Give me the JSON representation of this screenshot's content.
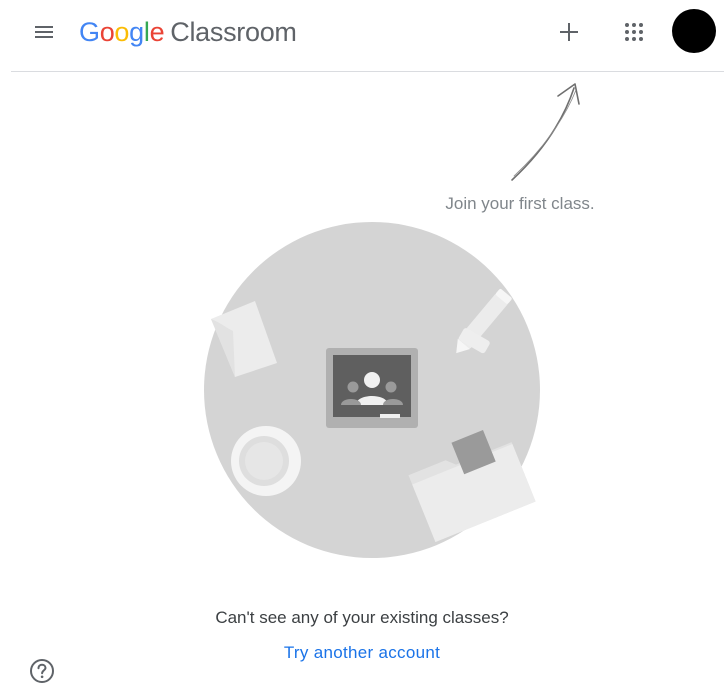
{
  "header": {
    "logo_google_letters": [
      "G",
      "o",
      "o",
      "g",
      "l",
      "e"
    ],
    "logo_product": "Classroom",
    "icons": {
      "menu": "hamburger-menu-icon",
      "add": "plus-icon",
      "apps": "apps-grid-icon",
      "avatar": "account-avatar"
    }
  },
  "colors": {
    "google_blue": "#4285F4",
    "google_red": "#EA4335",
    "google_yellow": "#FBBC05",
    "google_green": "#34A853",
    "link": "#1a73e8",
    "illustration_circle": "#d4d4d4"
  },
  "main": {
    "hint": "Join your first class.",
    "message": "Can't see any of your existing classes?",
    "link_label": "Try another account"
  },
  "footer": {
    "help_icon": "help-circle-icon"
  }
}
